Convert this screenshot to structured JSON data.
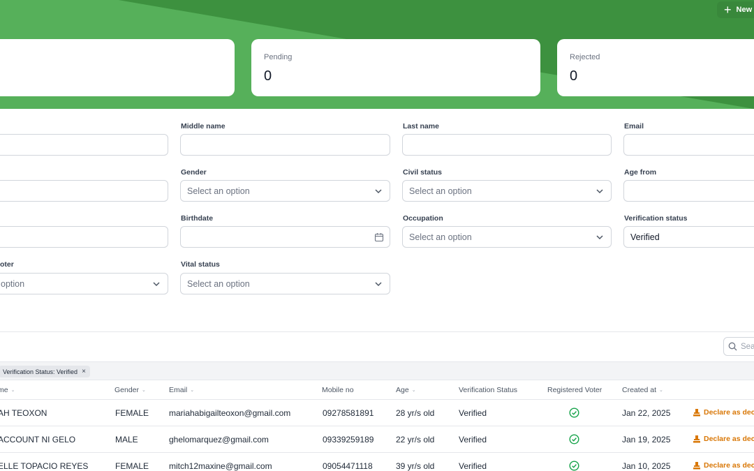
{
  "header": {
    "new_button_label": "New",
    "colors": {
      "green": "#4aa34c",
      "green_dark": "#3c8f3f",
      "green_light": "#5db75d"
    }
  },
  "stats": [
    {
      "label": "",
      "value": ""
    },
    {
      "label": "Pending",
      "value": "0"
    },
    {
      "label": "Rejected",
      "value": "0"
    }
  ],
  "filters": {
    "row1": [
      {
        "label": "",
        "value": "",
        "placeholder": ""
      },
      {
        "label": "Middle name",
        "value": "",
        "placeholder": ""
      },
      {
        "label": "Last name",
        "value": "",
        "placeholder": ""
      },
      {
        "label": "Email",
        "value": "",
        "placeholder": ""
      }
    ],
    "row2": [
      {
        "label": "",
        "value": "",
        "placeholder": ""
      },
      {
        "label": "Gender",
        "value": "Select an option"
      },
      {
        "label": "Civil status",
        "value": "Select an option"
      },
      {
        "label": "Age from",
        "value": ""
      }
    ],
    "row3": [
      {
        "label": "",
        "value": ""
      },
      {
        "label": "Birthdate",
        "value": ""
      },
      {
        "label": "Occupation",
        "value": "Select an option"
      },
      {
        "label": "Verification status",
        "value": "Verified"
      }
    ],
    "row4": [
      {
        "label": "oter",
        "value": "option"
      },
      {
        "label": "Vital status",
        "value": "Select an option"
      }
    ]
  },
  "table": {
    "search_placeholder": "Sea",
    "active_filter": "Verification Status: Verified",
    "active_filter_remove": "×",
    "columns": {
      "name": "me",
      "gender": "Gender",
      "email": "Email",
      "mobile": "Mobile no",
      "age": "Age",
      "verification": "Verification Status",
      "registered": "Registered Voter",
      "created": "Created at"
    },
    "rows": [
      {
        "name": "AH TEOXON",
        "gender": "FEMALE",
        "email": "mariahabigailteoxon@gmail.com",
        "mobile": "09278581891",
        "age": "28 yr/s old",
        "verification": "Verified",
        "created": "Jan 22, 2025",
        "action": "Declare as dece"
      },
      {
        "name": "ACCOUNT NI GELO",
        "gender": "MALE",
        "email": "ghelomarquez@gmail.com",
        "mobile": "09339259189",
        "age": "22 yr/s old",
        "verification": "Verified",
        "created": "Jan 19, 2025",
        "action": "Declare as dece"
      },
      {
        "name": "ELLE TOPACIO REYES",
        "gender": "FEMALE",
        "email": "mitch12maxine@gmail.com",
        "mobile": "09054471118",
        "age": "39 yr/s old",
        "verification": "Verified",
        "created": "Jan 10, 2025",
        "action": "Declare as dece"
      }
    ]
  }
}
